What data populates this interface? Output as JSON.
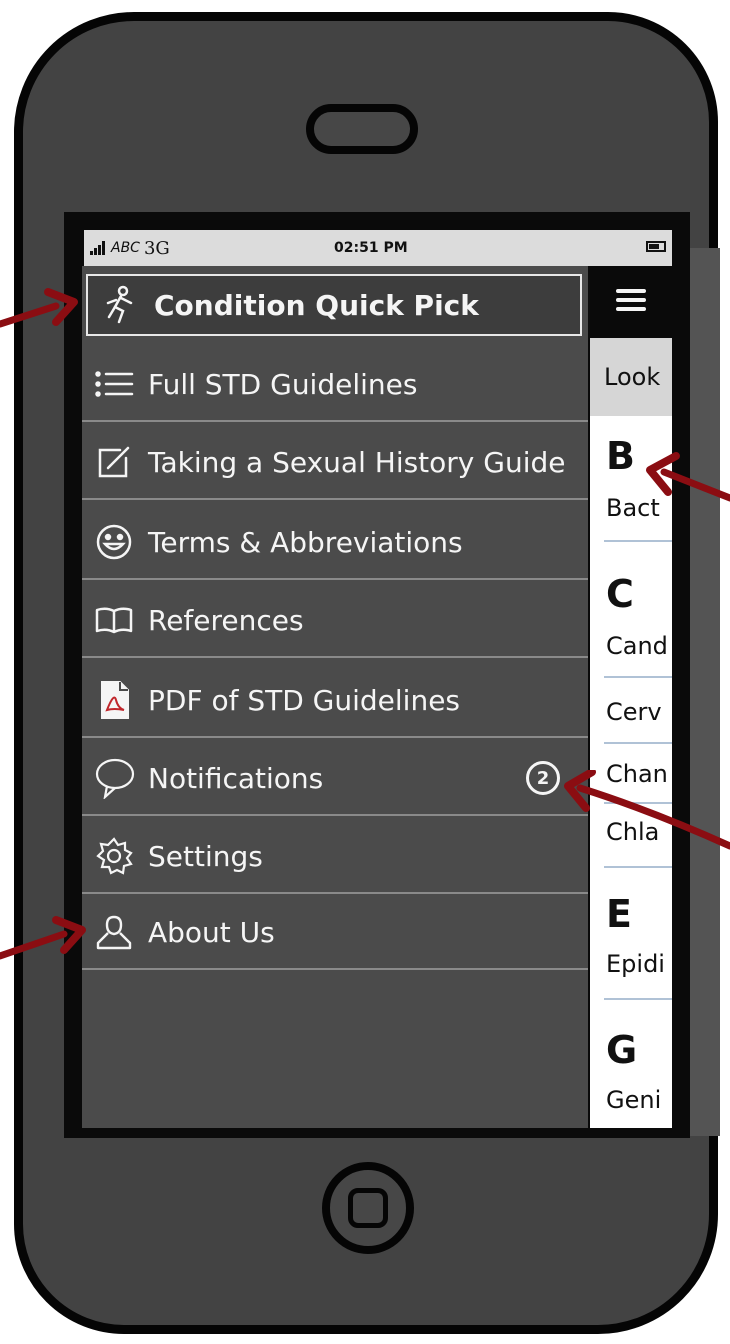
{
  "status_bar": {
    "carrier": "ABC",
    "network": "3G",
    "time": "02:51 PM"
  },
  "menu": {
    "items": [
      {
        "label": "Condition Quick Pick",
        "icon": "running-person-icon",
        "selected": true
      },
      {
        "label": "Full STD Guidelines",
        "icon": "list-icon"
      },
      {
        "label": "Taking a Sexual History Guide",
        "icon": "edit-icon"
      },
      {
        "label": "Terms & Abbreviations",
        "icon": "smiley-icon"
      },
      {
        "label": "References",
        "icon": "open-book-icon"
      },
      {
        "label": "PDF of STD Guidelines",
        "icon": "pdf-icon"
      },
      {
        "label": "Notifications",
        "icon": "speech-bubble-icon",
        "badge": "2"
      },
      {
        "label": "Settings",
        "icon": "gear-icon"
      },
      {
        "label": "About Us",
        "icon": "user-icon"
      }
    ]
  },
  "side_panel": {
    "menu_icon": "hamburger-icon",
    "search_text": "Look",
    "sections": [
      {
        "letter": "B",
        "items": [
          "Bact"
        ]
      },
      {
        "letter": "C",
        "items": [
          "Cand",
          "Cerv",
          "Chan",
          "Chla"
        ]
      },
      {
        "letter": "E",
        "items": [
          "Epidi"
        ]
      },
      {
        "letter": "G",
        "items": [
          "Geni"
        ]
      }
    ]
  },
  "colors": {
    "phone_body": "#434343",
    "menu_bg": "#4b4b4b",
    "annotation_arrow": "#8b0d12"
  }
}
